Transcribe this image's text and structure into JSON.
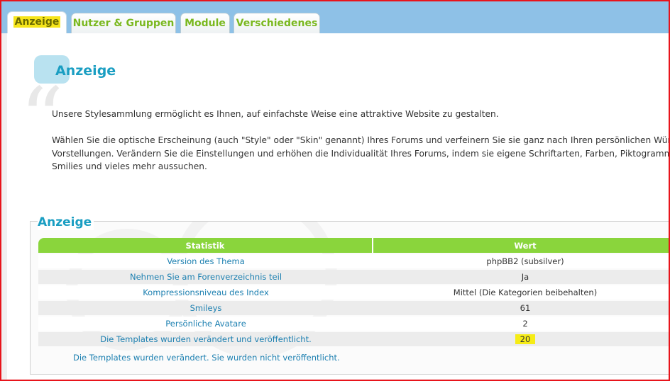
{
  "tabs": [
    {
      "label": "Anzeige",
      "active": true
    },
    {
      "label": "Nutzer & Gruppen",
      "active": false
    },
    {
      "label": "Module",
      "active": false
    },
    {
      "label": "Verschiedenes",
      "active": false
    }
  ],
  "page": {
    "title": "Anzeige",
    "intro_1": "Unsere Stylesammlung ermöglicht es Ihnen, auf einfachste Weise eine attraktive Website zu gestalten.",
    "intro_2_line1": "Wählen Sie die optische Erscheinung (auch \"Style\" oder \"Skin\" genannt) Ihres Forums und verfeinern Sie sie ganz nach Ihren persönlichen Wünschen und",
    "intro_2_line2": "Vorstellungen. Verändern Sie die Einstellungen und erhöhen die Individualität Ihres Forums, indem sie eigene Schriftarten, Farben, Piktogramme, Bilder,",
    "intro_2_line3": "Smilies und vieles mehr aussuchen."
  },
  "panel": {
    "title": "Anzeige",
    "headers": {
      "statistic": "Statistik",
      "value": "Wert"
    },
    "rows": [
      {
        "label": "Version des Thema",
        "value": "phpBB2 (subsilver)"
      },
      {
        "label": "Nehmen Sie am Forenverzeichnis teil",
        "value": "Ja"
      },
      {
        "label": "Kompressionsniveau des Index",
        "value": "Mittel (Die Kategorien beibehalten)"
      },
      {
        "label": "Smileys",
        "value": "61"
      },
      {
        "label": "Persönliche Avatare",
        "value": "2"
      },
      {
        "label": "Die Templates wurden verändert und veröffentlicht.",
        "value": "20"
      }
    ],
    "status_line": "Die Templates wurden verändert. Sie wurden nicht veröffentlicht."
  },
  "colors": {
    "tab_bar": "#8ec1e7",
    "accent_green": "#8ad53c",
    "title_blue": "#1a9ec2",
    "link_blue": "#1b7fb0",
    "highlight_yellow": "#f6ec16",
    "frame_red": "#e8141b"
  }
}
